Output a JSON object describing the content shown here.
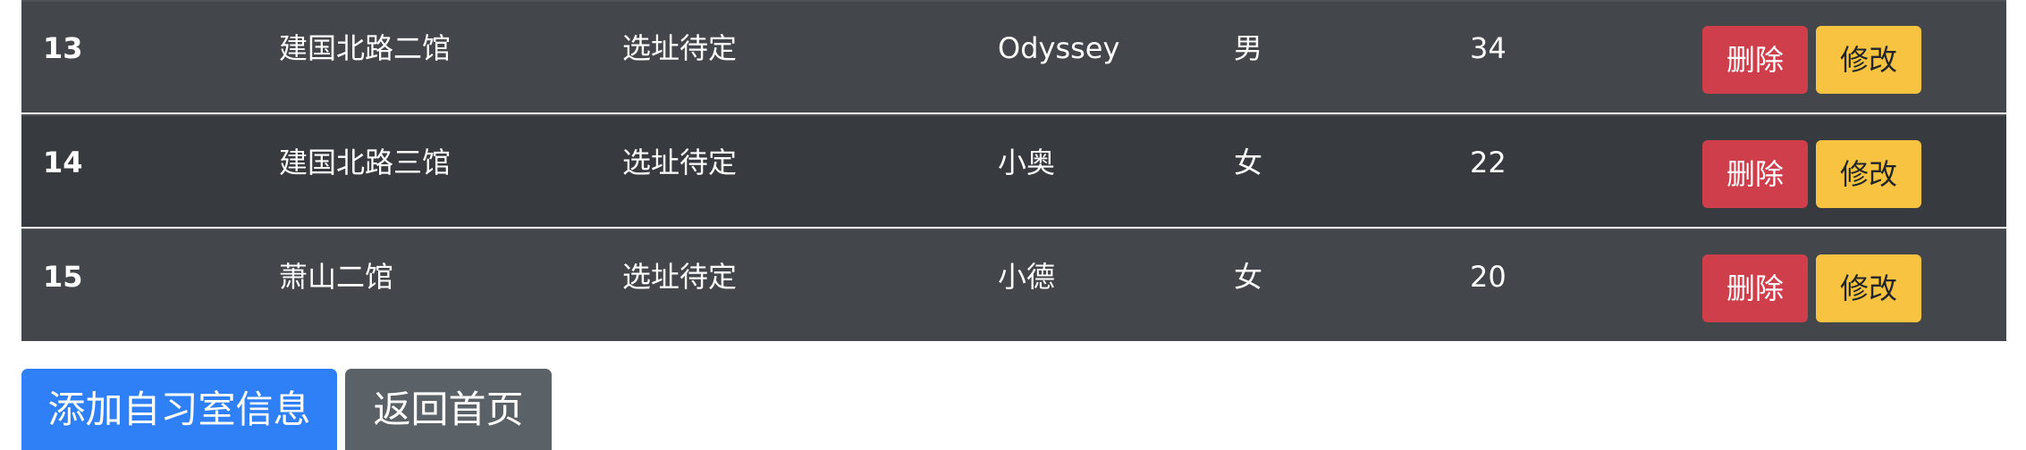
{
  "table": {
    "rows": [
      {
        "id": "13",
        "name": "建国北路二馆",
        "location": "选址待定",
        "manager": "Odyssey",
        "gender": "男",
        "age": "34"
      },
      {
        "id": "14",
        "name": "建国北路三馆",
        "location": "选址待定",
        "manager": "小奥",
        "gender": "女",
        "age": "22"
      },
      {
        "id": "15",
        "name": "萧山二馆",
        "location": "选址待定",
        "manager": "小德",
        "gender": "女",
        "age": "20"
      }
    ],
    "delete_label": "删除",
    "edit_label": "修改"
  },
  "actions": {
    "add_label": "添加自习室信息",
    "home_label": "返回首页"
  },
  "colors": {
    "row_odd": "#43474c",
    "row_even": "#373b40",
    "danger": "#cf3f4b",
    "warning": "#f7c340",
    "primary": "#2f7ff7",
    "secondary": "#5a6268"
  }
}
